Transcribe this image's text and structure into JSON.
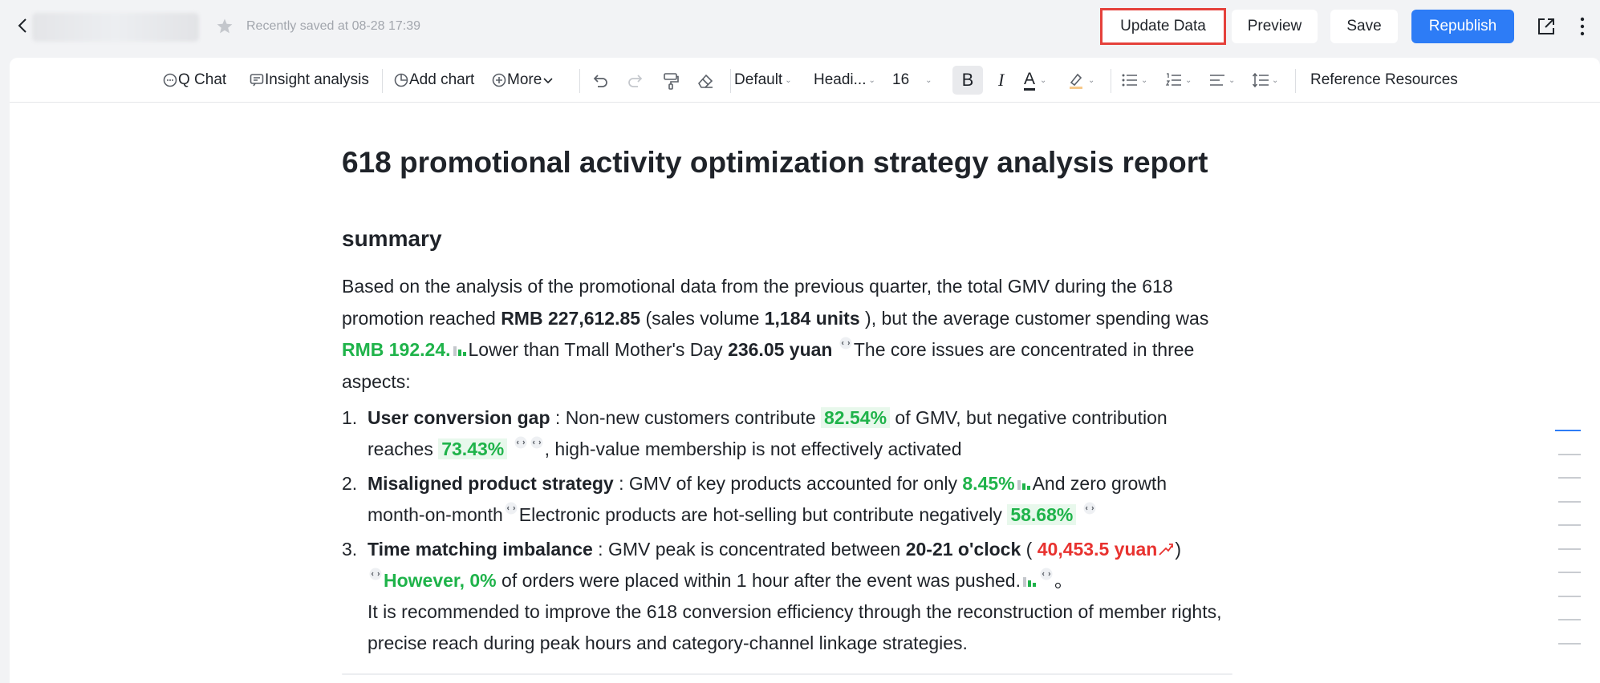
{
  "header": {
    "saved_text": "Recently saved at 08-28 17:39",
    "buttons": {
      "update": "Update Data",
      "preview": "Preview",
      "save": "Save",
      "republish": "Republish"
    }
  },
  "toolbar": {
    "q_chat": "Q Chat",
    "insight": "Insight analysis",
    "add_chart": "Add chart",
    "more": "More",
    "font": "Default",
    "style": "Headi...",
    "size": "16",
    "bold": "B",
    "italic": "I",
    "font_color": "A",
    "reference": "Reference Resources"
  },
  "document": {
    "title": "618 promotional activity optimization strategy analysis report",
    "section": "summary",
    "summary": {
      "t1": "Based on the analysis of the promotional data from the previous quarter, the total GMV during the 618 promotion reached ",
      "gmv": "RMB 227,612.85",
      "t2": " (sales volume ",
      "units": "1,184 units",
      "t3": " ), but the average customer spending was ",
      "avg": "RMB 192.24.",
      "t4": "Lower than Tmall Mother's Day ",
      "mothers": "236.05 yuan",
      "t5": "The core issues are concentrated in three aspects:"
    },
    "items": [
      {
        "num": "1.",
        "head": "User conversion gap",
        "a": " : Non-new customers contribute ",
        "v1": "82.54%",
        "b": "of GMV, but negative contribution reaches ",
        "v2": "73.43%",
        "c": ", high-value membership is not effectively activated"
      },
      {
        "num": "2.",
        "head": "Misaligned product strategy",
        "a": " : GMV of key products accounted for only ",
        "v1": "8.45%",
        "b": "And zero growth month-on-month",
        "c": "Electronic products are hot-selling but contribute negatively ",
        "v2": "58.68%"
      },
      {
        "num": "3.",
        "head": "Time matching imbalance",
        "a": " : GMV peak is concentrated between ",
        "v1": "20-21 o'clock",
        "b": " ( ",
        "v2": "40,453.5 yuan",
        "c": ")",
        "v3": "However, 0%",
        "d": " of orders were placed within 1 hour after the event was pushed.",
        "e": "。"
      }
    ],
    "recommendation": "It is recommended to improve the 618 conversion efficiency through the reconstruction of member rights, precise reach during peak hours and category-channel linkage strategies."
  },
  "colors": {
    "accent": "#2d7cf6",
    "positive": "#1fb34a",
    "negative": "#e8322f",
    "highlight_border": "#e5413b"
  }
}
